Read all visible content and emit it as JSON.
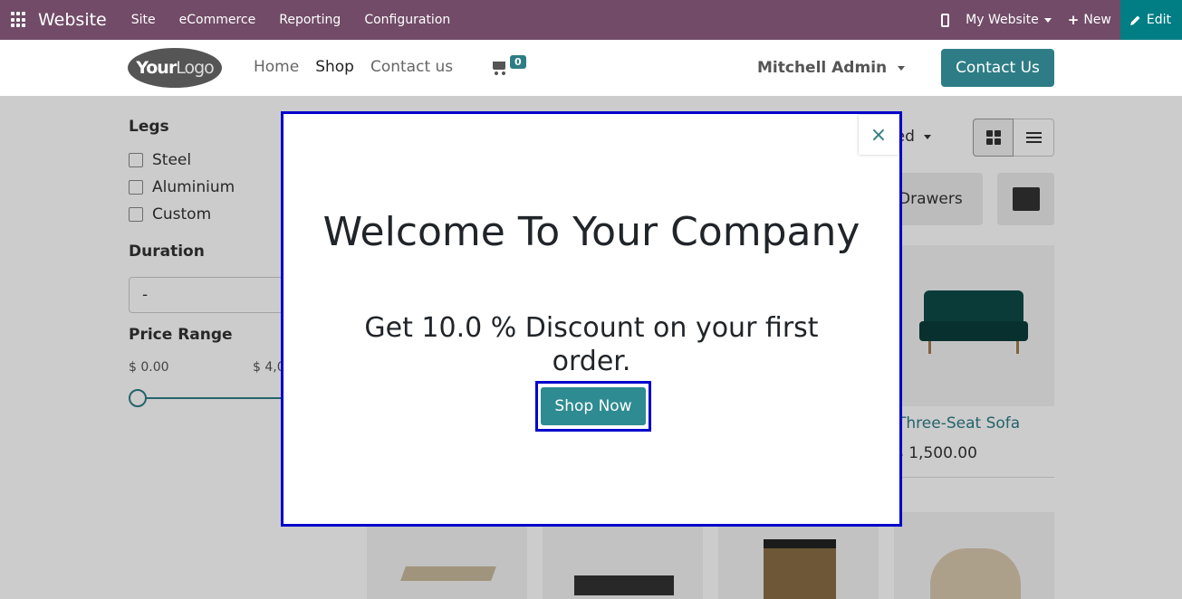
{
  "admin_bar": {
    "brand": "Website",
    "menu": [
      "Site",
      "eCommerce",
      "Reporting",
      "Configuration"
    ],
    "website_selector": "My Website",
    "new_label": "New",
    "edit_label": "Edit"
  },
  "header": {
    "logo_bold": "Your",
    "logo_light": "Logo",
    "nav": [
      "Home",
      "Shop",
      "Contact us"
    ],
    "cart_count": "0",
    "user": "Mitchell Admin",
    "contact_button": "Contact Us"
  },
  "sidebar": {
    "legs_title": "Legs",
    "legs_options": [
      "Steel",
      "Aluminium",
      "Custom"
    ],
    "duration_title": "Duration",
    "duration_value": "-",
    "price_title": "Price Range",
    "price_min": "$ 0.00",
    "price_max_partial": "$ 4,0"
  },
  "toolbar": {
    "sort_partial": "red"
  },
  "categories": {
    "chip_partial": "Drawers"
  },
  "product": {
    "name_partial": "Three-Seat Sofa",
    "price_partial": "$ 1,500.00"
  },
  "modal": {
    "title": "Welcome To Your Company",
    "subtitle": "Get 10.0 % Discount on your first order.",
    "button": "Shop Now",
    "close_symbol": "×"
  }
}
